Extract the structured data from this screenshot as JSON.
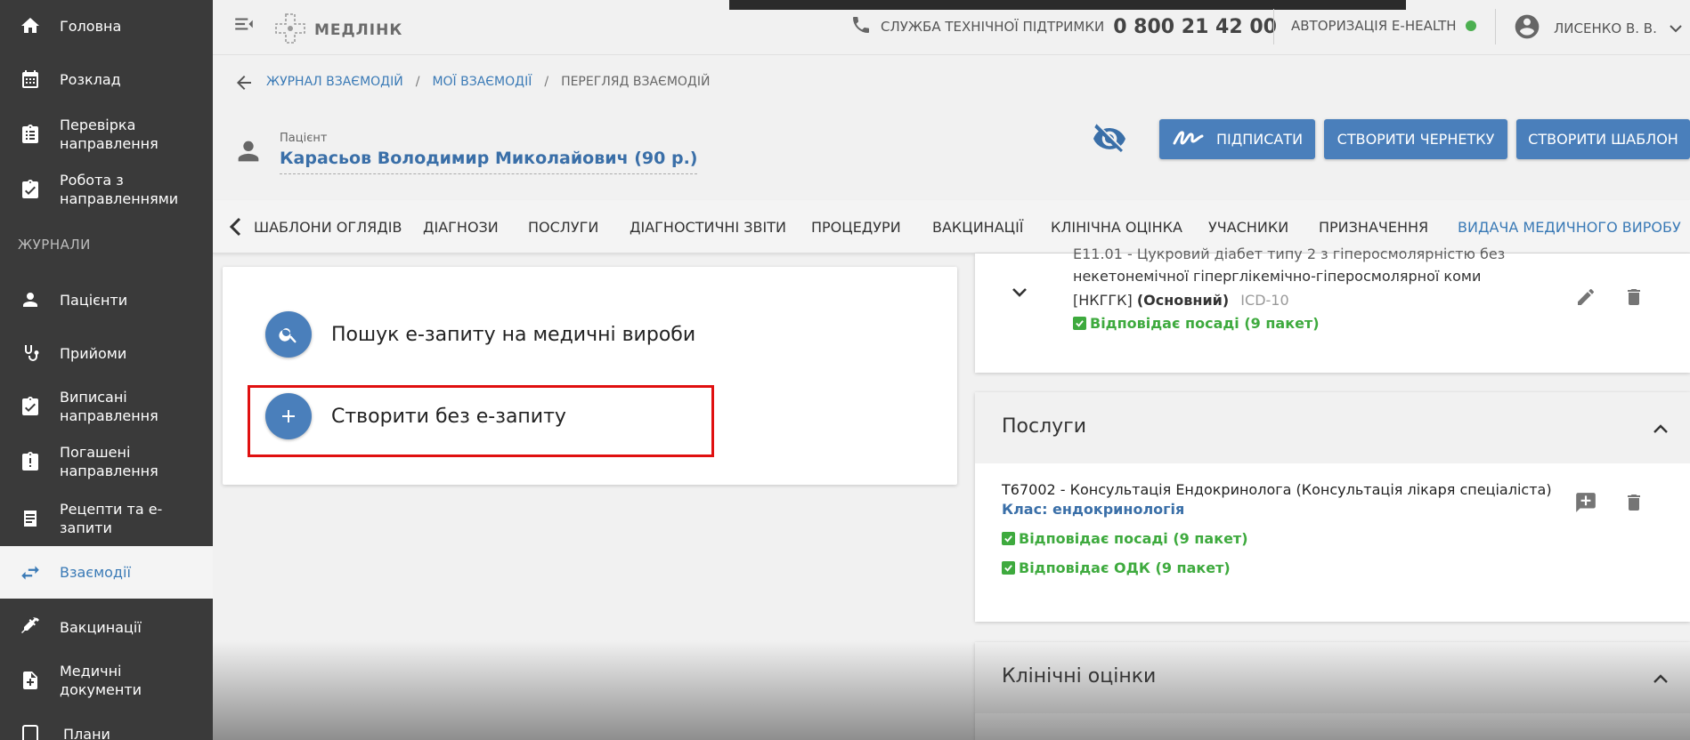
{
  "sidebar": {
    "items_top": [
      {
        "label": "Головна",
        "icon": "home-icon"
      },
      {
        "label": "Розклад",
        "icon": "calendar-icon"
      },
      {
        "label": "Перевірка направлення",
        "icon": "clipboard-list-icon"
      },
      {
        "label": "Робота з направленнями",
        "icon": "clipboard-check-icon"
      }
    ],
    "section_label": "ЖУРНАЛИ",
    "items_journals": [
      {
        "label": "Пацієнти",
        "icon": "person-icon"
      },
      {
        "label": "Прийоми",
        "icon": "stethoscope-icon"
      },
      {
        "label": "Виписані направлення",
        "icon": "clipboard-check-icon"
      },
      {
        "label": "Погашені направлення",
        "icon": "clipboard-alert-icon"
      },
      {
        "label": "Рецепти та е-запити",
        "icon": "receipt-icon"
      },
      {
        "label": "Взаємодії",
        "icon": "swap-icon",
        "active": true
      },
      {
        "label": "Вакцинації",
        "icon": "syringe-icon"
      },
      {
        "label": "Медичні документи",
        "icon": "document-plus-icon"
      },
      {
        "label": "Плани",
        "icon": "plan-icon"
      }
    ]
  },
  "header": {
    "logo_text": "МЕДЛІНК",
    "support_label": "СЛУЖБА ТЕХНІЧНОЇ ПІДТРИМКИ",
    "support_phone": "0 800 21 42 00",
    "ehealth_label": "АВТОРИЗАЦІЯ E-HEALTH",
    "ehealth_status_color": "#4caf50",
    "user_name": "ЛИСЕНКО В. В."
  },
  "breadcrumb": {
    "items": [
      "ЖУРНАЛ ВЗАЄМОДІЙ",
      "МОЇ ВЗАЄМОДІЇ",
      "ПЕРЕГЛЯД ВЗАЄМОДІЙ"
    ],
    "separator": "/"
  },
  "patient": {
    "caption": "Пацієнт",
    "name": "Карасьов Володимир Миколайович (90 р.)"
  },
  "actions": {
    "sign": "ПІДПИСАТИ",
    "draft": "СТВОРИТИ ЧЕРНЕТКУ",
    "template": "СТВОРИТИ ШАБЛОН"
  },
  "tabs": [
    "ШАБЛОНИ ОГЛЯДІВ",
    "ДІАГНОЗИ",
    "ПОСЛУГИ",
    "ДІАГНОСТИЧНІ ЗВІТИ",
    "ПРОЦЕДУРИ",
    "ВАКЦИНАЦІЇ",
    "КЛІНІЧНА ОЦІНКА",
    "УЧАСНИКИ",
    "ПРИЗНАЧЕННЯ",
    "ВИДАЧА МЕДИЧНОГО ВИРОБУ"
  ],
  "left_card": {
    "search_label": "Пошук е-запиту на медичні вироби",
    "create_label": "Створити без е-запиту"
  },
  "diagnosis": {
    "line1": "E11.01 - Цукровий діабет типу 2 з гіперосмолярністю без",
    "line2": "некетонемічної гіперглікемічно-гіперосмолярної коми",
    "line3_code": "[НКГГК]",
    "line3_bold": "(Основний)",
    "line3_system": "ICD-10",
    "status": "Відповідає посаді (9 пакет)"
  },
  "services": {
    "title": "Послуги",
    "item": "Т67002 - Консультація Ендокринолога (Консультація лікаря спеціаліста)",
    "class": "Клас: ендокринологія",
    "status1": "Відповідає посаді (9 пакет)",
    "status2": "Відповідає ОДК (9 пакет)"
  },
  "clinical": {
    "title": "Клінічні оцінки"
  }
}
